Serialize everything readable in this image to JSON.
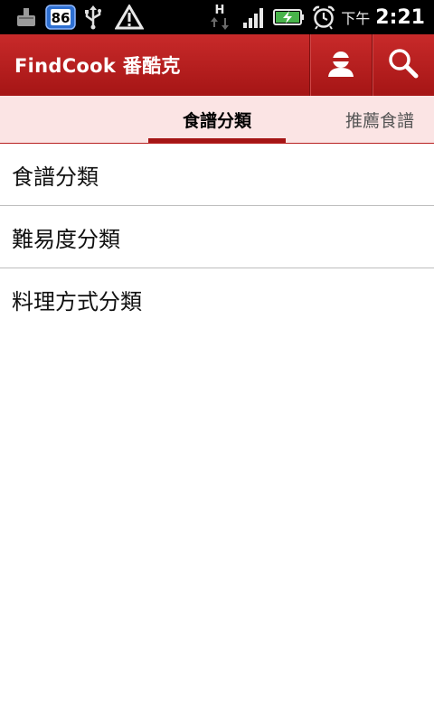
{
  "status_bar": {
    "notification_count": "86",
    "ampm": "下午",
    "time": "2:21",
    "network_label": "H",
    "icons": [
      "download-icon",
      "usb-icon",
      "warning-icon",
      "network-h-icon",
      "signal-icon",
      "battery-charging-icon",
      "alarm-icon"
    ]
  },
  "action_bar": {
    "title": "FindCook 番酷克",
    "buttons": [
      "profile-icon",
      "search-icon"
    ],
    "color": "#b51f1f"
  },
  "tabs": {
    "active_label": "食譜分類",
    "next_label": "推薦食譜"
  },
  "list": {
    "items": [
      {
        "label": "食譜分類"
      },
      {
        "label": "難易度分類"
      },
      {
        "label": "料理方式分類"
      }
    ]
  }
}
